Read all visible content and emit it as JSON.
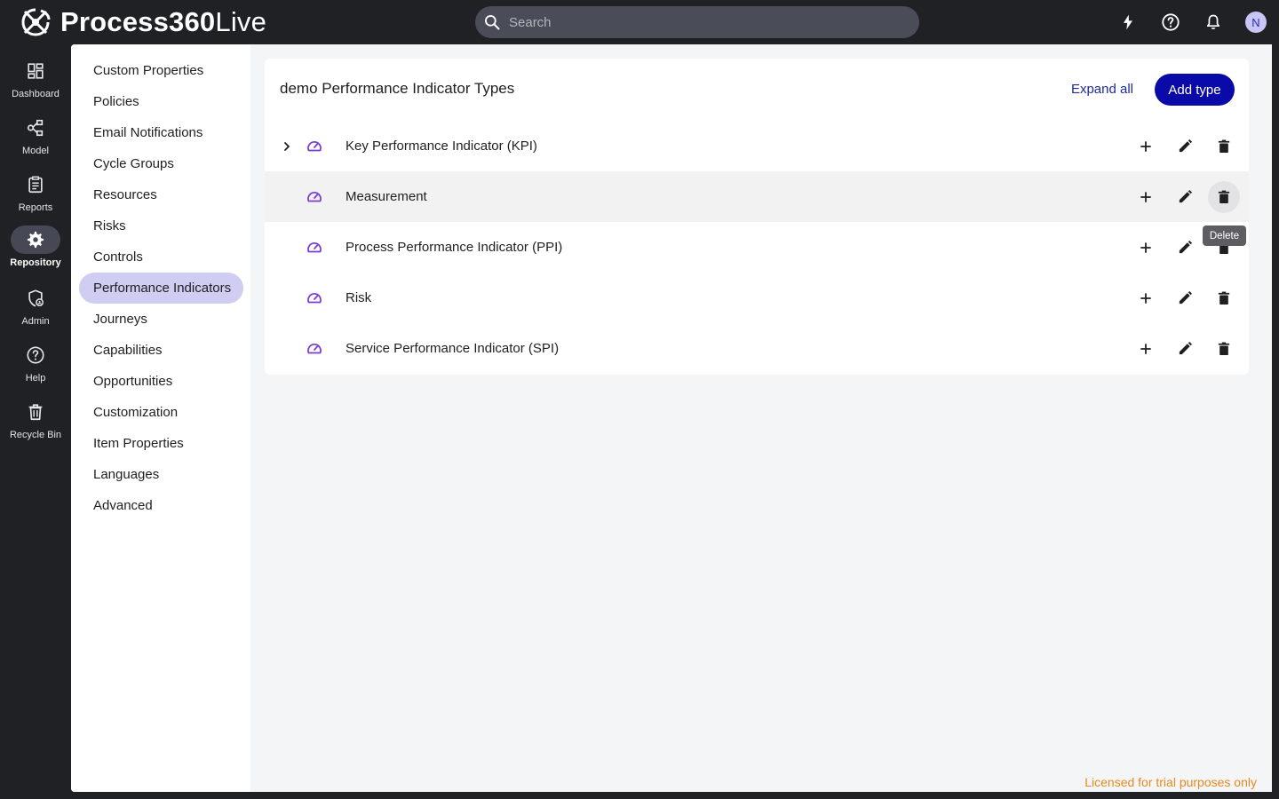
{
  "app": {
    "brand_bold": "Process360",
    "brand_light": "Live",
    "search_placeholder": "Search",
    "avatar_initial": "N"
  },
  "rail": [
    {
      "label": "Dashboard",
      "icon": "dashboard-icon"
    },
    {
      "label": "Model",
      "icon": "model-icon"
    },
    {
      "label": "Reports",
      "icon": "reports-icon"
    },
    {
      "label": "Repository",
      "icon": "gear-icon",
      "active": true
    },
    {
      "label": "Admin",
      "icon": "admin-shield-icon"
    },
    {
      "label": "Help",
      "icon": "help-icon"
    },
    {
      "label": "Recycle Bin",
      "icon": "recycle-bin-icon"
    }
  ],
  "subnav": [
    "Custom Properties",
    "Policies",
    "Email Notifications",
    "Cycle Groups",
    "Resources",
    "Risks",
    "Controls",
    "Performance Indicators",
    "Journeys",
    "Capabilities",
    "Opportunities",
    "Customization",
    "Item Properties",
    "Languages",
    "Advanced"
  ],
  "subnav_active": "Performance Indicators",
  "card": {
    "title": "demo Performance Indicator Types",
    "expand_all": "Expand all",
    "add_type": "Add type"
  },
  "rows": [
    {
      "label": "Key Performance Indicator (KPI)",
      "expandable": true
    },
    {
      "label": "Measurement",
      "expandable": false
    },
    {
      "label": "Process Performance Indicator (PPI)",
      "expandable": false
    },
    {
      "label": "Risk",
      "expandable": false
    },
    {
      "label": "Service Performance Indicator (SPI)",
      "expandable": false
    }
  ],
  "tooltip": "Delete",
  "license_text": "Licensed for trial purposes only",
  "colors": {
    "accent": "#0a0aa8",
    "gauge": "#7b3fd0",
    "license": "#e58a1f",
    "active_nav": "#cfcdf1"
  }
}
